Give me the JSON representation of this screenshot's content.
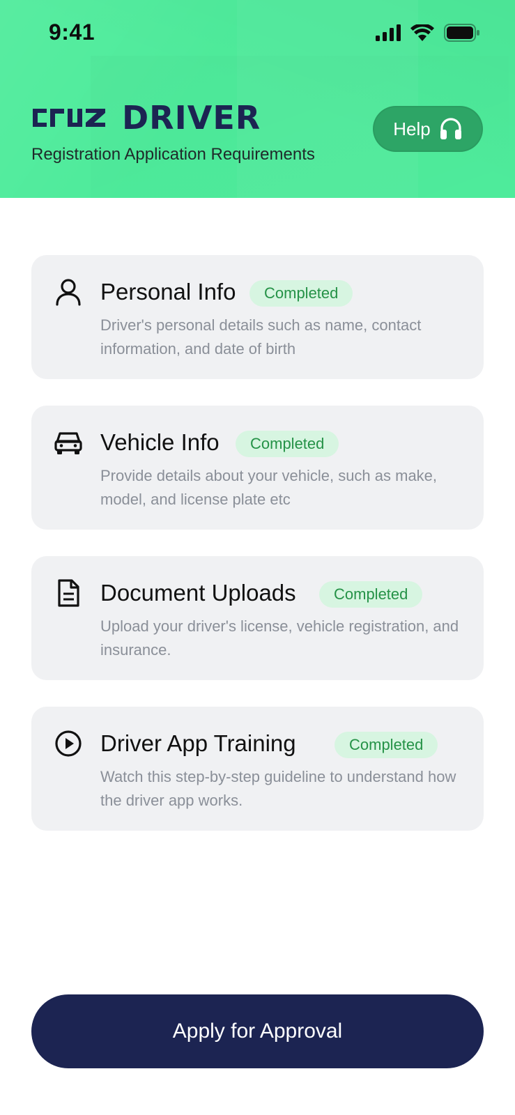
{
  "status_bar": {
    "time": "9:41"
  },
  "header": {
    "brand_name": "DRIVER",
    "brand_logo": "cruz",
    "subtitle": "Registration Application Requirements",
    "help_label": "Help",
    "background_color": "#4eeb9b"
  },
  "requirements": [
    {
      "title": "Personal Info",
      "status": "Completed",
      "description": "Driver's personal details such as name, contact information, and date of birth",
      "icon": "user-icon"
    },
    {
      "title": "Vehicle Info",
      "status": "Completed",
      "description": "Provide details about your vehicle, such as make, model, and license plate etc",
      "icon": "car-icon"
    },
    {
      "title": "Document Uploads",
      "status": "Completed",
      "description": "Upload your driver's license, vehicle registration, and insurance.",
      "icon": "document-icon"
    },
    {
      "title": "Driver App Training",
      "status": "Completed",
      "description": "Watch this step-by-step guideline to understand how the driver app works.",
      "icon": "play-circle-icon"
    }
  ],
  "footer": {
    "apply_label": "Apply for Approval",
    "button_color": "#1c2452"
  },
  "colors": {
    "accent_green": "#4eeb9b",
    "help_button": "#2da566",
    "badge_bg": "#d7f5e1",
    "badge_text": "#259247",
    "navy": "#1c2452"
  }
}
